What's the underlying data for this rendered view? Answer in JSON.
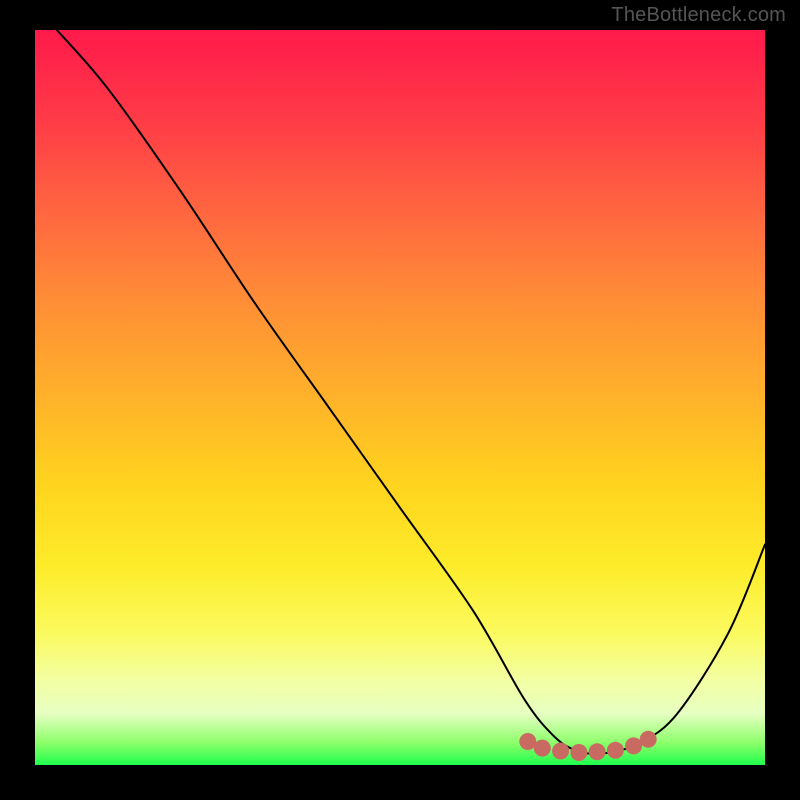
{
  "watermark": "TheBottleneck.com",
  "chart_data": {
    "type": "line",
    "title": "",
    "xlabel": "",
    "ylabel": "",
    "xlim": [
      0,
      100
    ],
    "ylim": [
      0,
      100
    ],
    "series": [
      {
        "name": "curve",
        "x": [
          3,
          10,
          20,
          30,
          40,
          50,
          60,
          67,
          71,
          74,
          77,
          80,
          83,
          88,
          95,
          100
        ],
        "y": [
          100,
          92,
          78,
          63,
          49,
          35,
          21,
          9,
          4,
          2,
          1.5,
          2,
          3,
          7,
          18,
          30
        ]
      }
    ],
    "markers": {
      "name": "bottom-dots",
      "color": "#c96a62",
      "points": [
        {
          "x": 67.5,
          "y": 3.2
        },
        {
          "x": 69.5,
          "y": 2.3
        },
        {
          "x": 72.0,
          "y": 1.9
        },
        {
          "x": 74.5,
          "y": 1.7
        },
        {
          "x": 77.0,
          "y": 1.8
        },
        {
          "x": 79.5,
          "y": 2.0
        },
        {
          "x": 82.0,
          "y": 2.6
        },
        {
          "x": 84.0,
          "y": 3.5
        }
      ]
    },
    "background": {
      "type": "vertical-gradient",
      "stops": [
        {
          "pos": 0,
          "color": "#ff1a4b"
        },
        {
          "pos": 50,
          "color": "#ffb22a"
        },
        {
          "pos": 85,
          "color": "#f7ff85"
        },
        {
          "pos": 100,
          "color": "#1fff4e"
        }
      ]
    }
  }
}
